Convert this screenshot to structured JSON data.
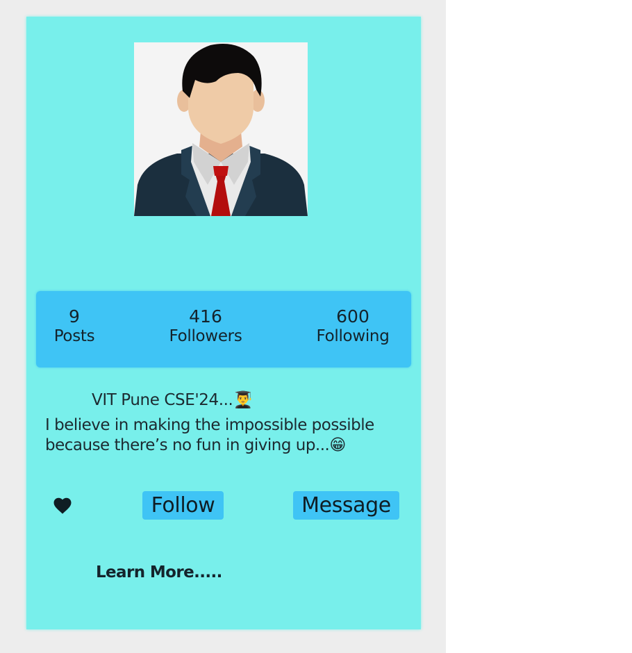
{
  "profile": {
    "avatar_icon": "businessman-avatar-icon",
    "stats": {
      "posts": {
        "count": "9",
        "label": "Posts"
      },
      "followers": {
        "count": "416",
        "label": "Followers"
      },
      "following": {
        "count": "600",
        "label": "Following"
      }
    },
    "bio_title": "VIT Pune CSE'24...👨‍🎓",
    "bio_text": "I believe in making the impossible possible because there’s no fun in giving up...😁"
  },
  "actions": {
    "like_icon": "heart-icon",
    "follow_label": "Follow",
    "message_label": "Message",
    "learn_more_label": "Learn More....."
  },
  "colors": {
    "card_background": "#78efeb",
    "accent": "#3fc4f5",
    "page_background": "#ededed"
  }
}
